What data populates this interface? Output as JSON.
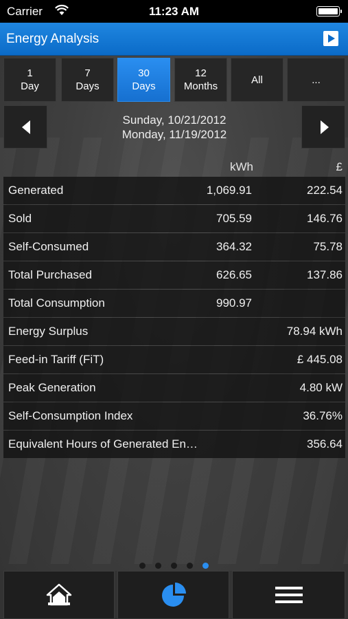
{
  "status_bar": {
    "carrier": "Carrier",
    "time": "11:23 AM"
  },
  "header": {
    "title": "Energy Analysis"
  },
  "periods": [
    {
      "label": "1\nDay",
      "active": false
    },
    {
      "label": "7\nDays",
      "active": false
    },
    {
      "label": "30\nDays",
      "active": true
    },
    {
      "label": "12\nMonths",
      "active": false
    },
    {
      "label": "All",
      "active": false
    },
    {
      "label": "...",
      "active": false
    }
  ],
  "date_range": {
    "start": "Sunday, 10/21/2012",
    "end": "Monday, 11/19/2012"
  },
  "table": {
    "col_kwh": "kWh",
    "col_currency": "£",
    "rows": [
      {
        "label": "Generated",
        "kwh": "1,069.91",
        "value": "222.54"
      },
      {
        "label": "Sold",
        "kwh": "705.59",
        "value": "146.76"
      },
      {
        "label": "Self-Consumed",
        "kwh": "364.32",
        "value": "75.78"
      },
      {
        "label": "Total Purchased",
        "kwh": "626.65",
        "value": "137.86"
      },
      {
        "label": "Total Consumption",
        "kwh": "990.97",
        "value": ""
      },
      {
        "label": "Energy Surplus",
        "kwh": "",
        "value": "78.94 kWh"
      },
      {
        "label": "Feed-in Tariff (FiT)",
        "kwh": "",
        "value": "£ 445.08"
      },
      {
        "label": "Peak Generation",
        "kwh": "",
        "value": "4.80 kW"
      },
      {
        "label": "Self-Consumption Index",
        "kwh": "",
        "value": "36.76%"
      },
      {
        "label": "Equivalent Hours of Generated En…",
        "kwh": "",
        "value": "356.64"
      }
    ]
  },
  "pager": {
    "count": 5,
    "active_index": 4
  },
  "tabbar": {
    "items": [
      "home-icon",
      "pie-chart-icon",
      "menu-icon"
    ],
    "active_index": 1,
    "accent": "#2a8ef0"
  }
}
